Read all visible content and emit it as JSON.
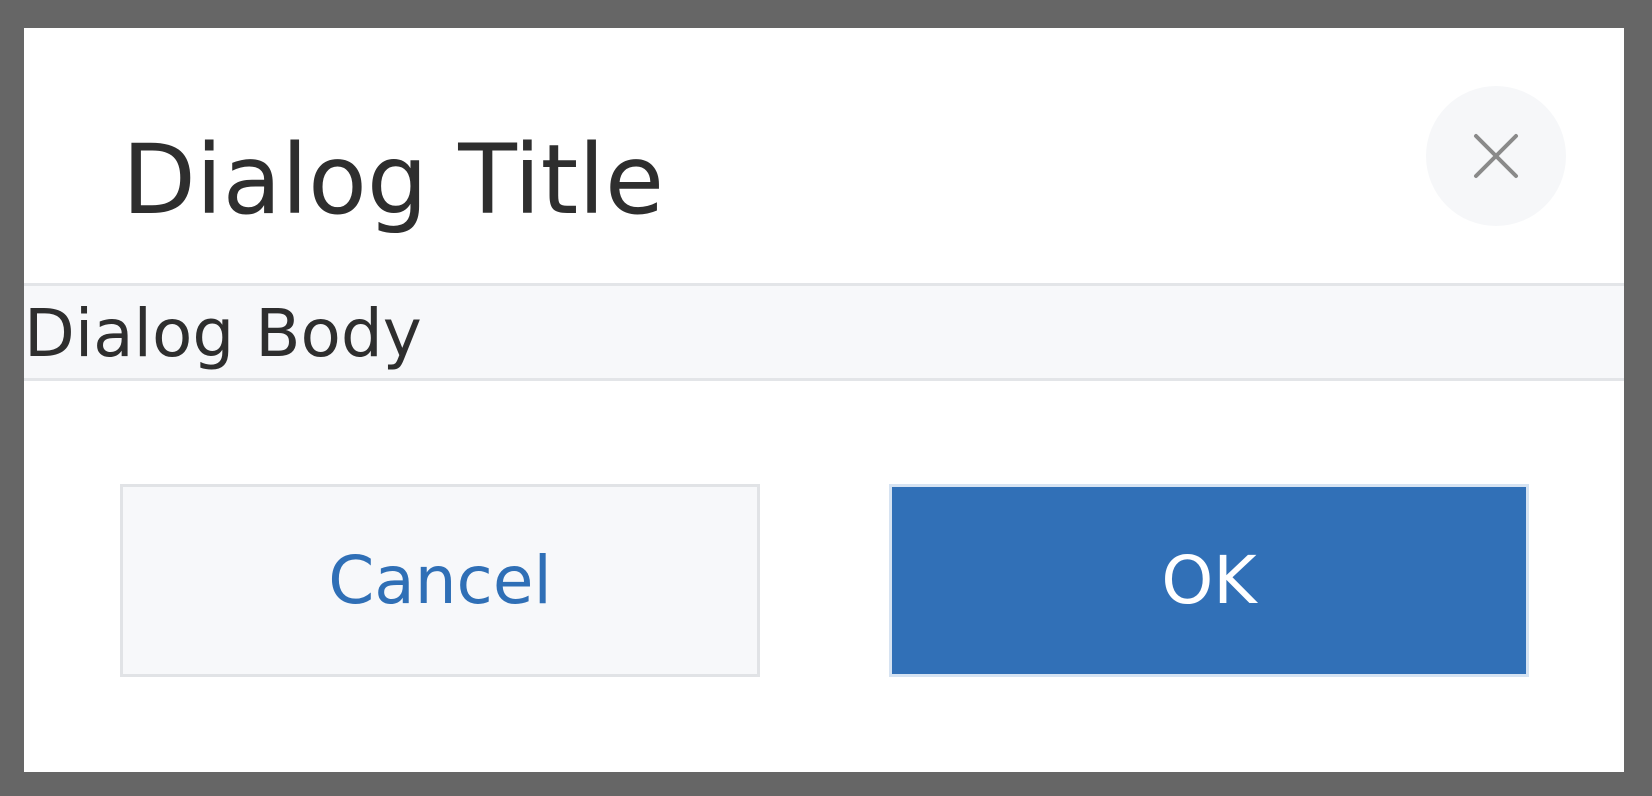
{
  "dialog": {
    "title": "Dialog Title",
    "body": "Dialog Body",
    "close_icon": "close-icon",
    "buttons": {
      "cancel_label": "Cancel",
      "ok_label": "OK"
    }
  },
  "colors": {
    "backdrop": "#666666",
    "dialog_background": "#ffffff",
    "body_background": "#f7f8fa",
    "primary": "#3170b7",
    "text": "#2e2e2e"
  }
}
